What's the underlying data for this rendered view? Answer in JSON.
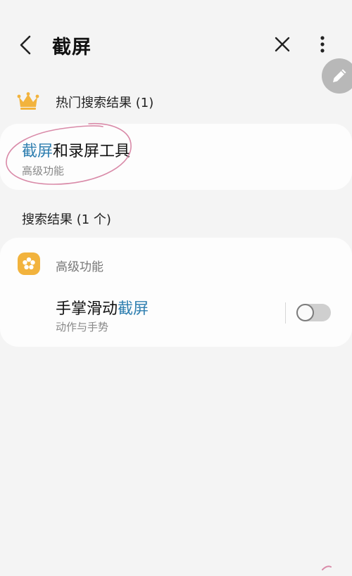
{
  "header": {
    "title": "截屏",
    "icons": {
      "back": "chevron-left-icon",
      "close": "close-icon",
      "more": "more-vertical-icon",
      "edit": "pencil-icon"
    }
  },
  "hot_section": {
    "icon": "crown-icon",
    "label": "热门搜索结果 (1)",
    "item": {
      "title_highlight": "截屏",
      "title_rest": "和录屏工具",
      "subtitle": "高级功能"
    }
  },
  "results_section": {
    "label": "搜索结果 (1 个)",
    "group": {
      "icon": "gear-flower-icon",
      "label": "高级功能"
    },
    "item": {
      "title_rest": "手掌滑动",
      "title_highlight": "截屏",
      "subtitle": "动作与手势",
      "toggle_on": false
    }
  },
  "colors": {
    "background": "#f4f4f4",
    "card": "#fdfdfd",
    "highlight": "#2f7fb0",
    "crown": "#f2b33d",
    "app_icon": "#f2b33d",
    "annotation": "#d98aa8"
  }
}
